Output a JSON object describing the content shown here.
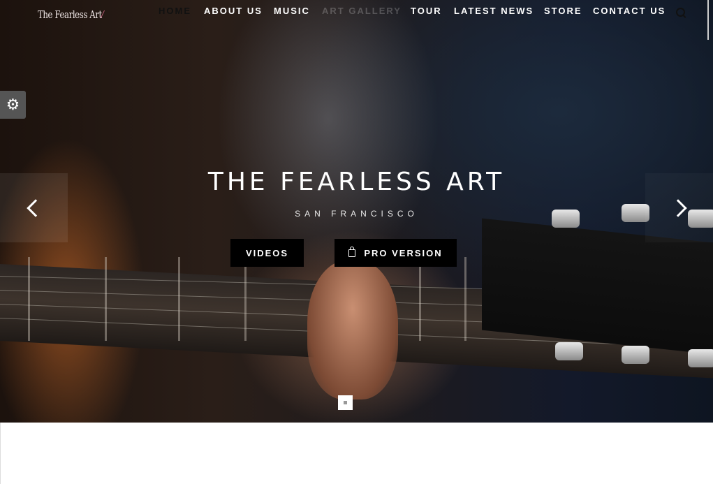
{
  "brand": {
    "logo_text": "The Fearless Art"
  },
  "nav": {
    "items": [
      {
        "label": "HOME",
        "active": true
      },
      {
        "label": "ABOUT US",
        "active": false
      },
      {
        "label": "MUSIC",
        "active": false
      },
      {
        "label": "ART GALLERY",
        "active": false
      },
      {
        "label": "TOUR",
        "active": false
      },
      {
        "label": "LATEST NEWS",
        "active": false
      },
      {
        "label": "STORE",
        "active": false
      },
      {
        "label": "CONTACT US",
        "active": false
      }
    ]
  },
  "hero": {
    "title": "THE FEARLESS ART",
    "subtitle": "SAN FRANCISCO",
    "buttons": {
      "videos": "VIDEOS",
      "pro": "PRO VERSION"
    }
  },
  "icons": {
    "search": "search-icon",
    "settings": "gear-icon",
    "prev": "chevron-left-icon",
    "next": "chevron-right-icon",
    "bag": "shopping-bag-icon"
  },
  "colors": {
    "button_bg": "#000000",
    "active_nav": "#111111",
    "nav_text": "#ffffff",
    "logo_accent": "#d76b8a"
  }
}
